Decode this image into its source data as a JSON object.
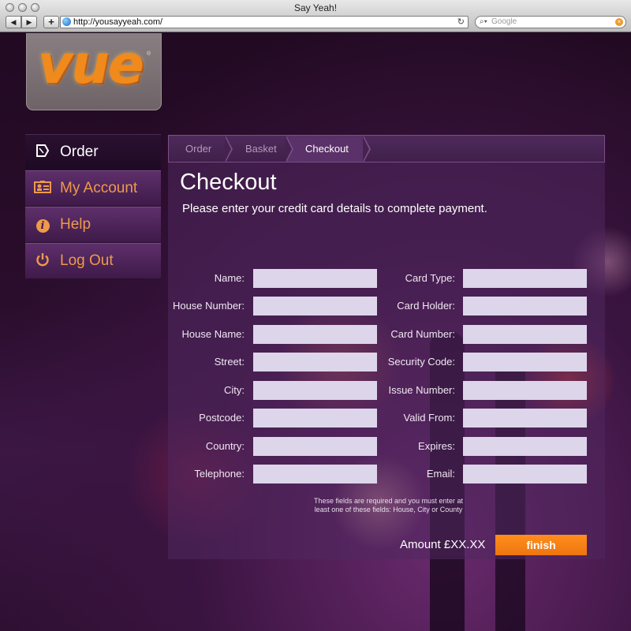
{
  "window": {
    "title": "Say Yeah!",
    "url": "http://yousayyeah.com/",
    "search_placeholder": "Google",
    "back_glyph": "◀",
    "forward_glyph": "▶",
    "add_glyph": "+",
    "reload_glyph": "↻",
    "search_glyph": "🔍",
    "clear_glyph": "×"
  },
  "logo": {
    "text": "vue",
    "mark": "®"
  },
  "sidebar": {
    "items": [
      {
        "label": "Order",
        "icon": "order-icon",
        "glyph": "⎘",
        "active": true
      },
      {
        "label": "My Account",
        "icon": "account-card-icon",
        "glyph": "🪪",
        "active": false
      },
      {
        "label": "Help",
        "icon": "info-icon",
        "glyph": "i",
        "active": false
      },
      {
        "label": "Log Out",
        "icon": "power-icon",
        "glyph": "⏻",
        "active": false
      }
    ]
  },
  "breadcrumb": {
    "items": [
      {
        "label": "Order"
      },
      {
        "label": "Basket"
      },
      {
        "label": "Checkout"
      }
    ]
  },
  "checkout": {
    "title": "Checkout",
    "subtitle": "Please enter your credit card details to complete payment.",
    "left_fields": [
      {
        "label": "Name:",
        "value": ""
      },
      {
        "label": "House Number:",
        "value": ""
      },
      {
        "label": "House Name:",
        "value": ""
      },
      {
        "label": "Street:",
        "value": ""
      },
      {
        "label": "City:",
        "value": ""
      },
      {
        "label": "Postcode:",
        "value": ""
      },
      {
        "label": "Country:",
        "value": ""
      },
      {
        "label": "Telephone:",
        "value": ""
      }
    ],
    "right_fields": [
      {
        "label": "Card Type:",
        "value": ""
      },
      {
        "label": "Card Holder:",
        "value": ""
      },
      {
        "label": "Card Number:",
        "value": ""
      },
      {
        "label": "Security Code:",
        "value": ""
      },
      {
        "label": "Issue Number:",
        "value": ""
      },
      {
        "label": "Valid From:",
        "value": ""
      },
      {
        "label": "Expires:",
        "value": ""
      },
      {
        "label": "Email:",
        "value": ""
      }
    ],
    "note": "These fields are required and you must enter at least one of these fields: House, City or County",
    "amount": "Amount £XX.XX",
    "finish_label": "finish"
  },
  "colors": {
    "accent": "#ee7410",
    "sidebar_text": "#ee9a4a",
    "input_bg": "#ddd5ea"
  }
}
